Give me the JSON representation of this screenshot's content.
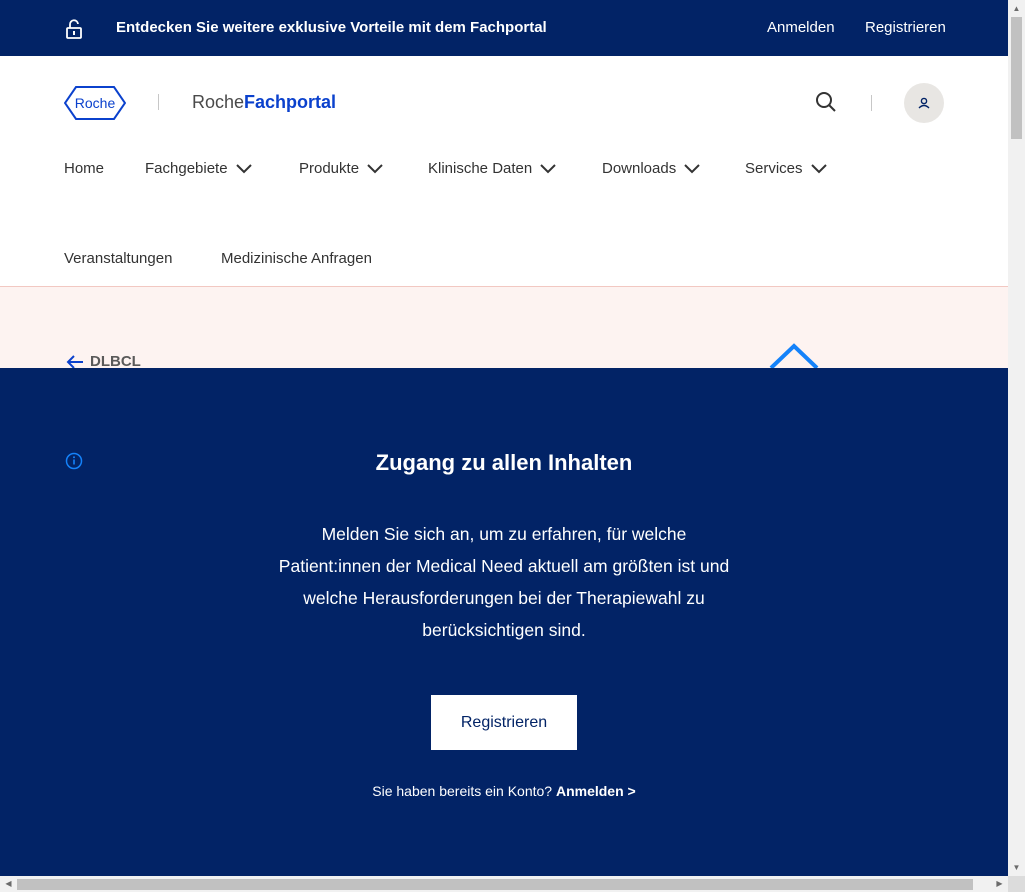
{
  "topbar": {
    "promo": "Entdecken Sie weitere exklusive Vorteile mit dem Fachportal",
    "login": "Anmelden",
    "register": "Registrieren"
  },
  "header": {
    "logo_text": "Roche",
    "portal_prefix": "Roche",
    "portal_name": "Fachportal"
  },
  "nav": {
    "items": [
      {
        "label": "Home"
      },
      {
        "label": "Fachgebiete"
      },
      {
        "label": "Produkte"
      },
      {
        "label": "Klinische Daten"
      },
      {
        "label": "Downloads"
      },
      {
        "label": "Services"
      },
      {
        "label": "Veranstaltungen"
      },
      {
        "label": "Medizinische Anfragen"
      }
    ]
  },
  "breadcrumb": {
    "back_label": "DLBCL"
  },
  "overlay": {
    "title": "Zugang zu allen Inhalten",
    "text": "Melden Sie sich an, um zu erfahren, für welche Patient:innen der Medical Need aktuell am größten ist und welche Herausforderungen bei der Therapiewahl zu berücksichtigen sind.",
    "button": "Registrieren",
    "account_question": "Sie haben bereits ein Konto?",
    "account_link": "Anmelden  >"
  },
  "colors": {
    "navy": "#022366",
    "brand_blue": "#0b41cd",
    "pink_bg": "#fdf3f1"
  }
}
